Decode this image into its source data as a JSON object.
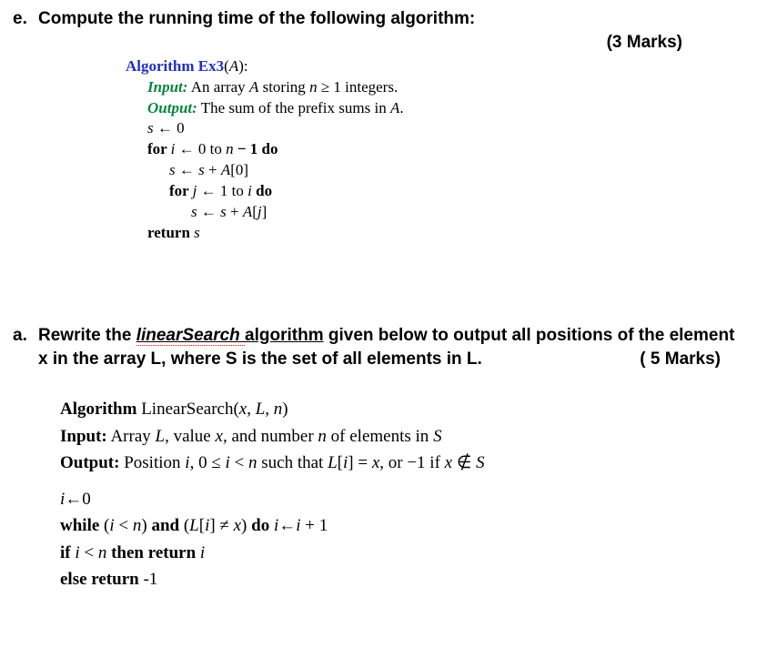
{
  "qE": {
    "letter": "e.",
    "text": "Compute the running time of the following algorithm:",
    "marks": "(3 Marks)",
    "algo": {
      "header": "Algorithm",
      "name": "Ex3",
      "paramOpen": "(",
      "param": "A",
      "paramClose": "):",
      "inputLabel": "Input:",
      "inputText1": " An array ",
      "inputA": "A",
      "inputText2": " storing ",
      "inputN": "n",
      "inputText3": " ≥ 1 integers.",
      "outputLabel": "Output:",
      "outputText1": " The sum of the prefix sums in ",
      "outputA": "A",
      "outputText2": ".",
      "l1a": "s",
      "l1b": " ← 0",
      "l2a": "for ",
      "l2b": "i",
      "l2c": " ← 0 to ",
      "l2d": "n",
      "l2e": " − 1 do",
      "l3a": "s",
      "l3b": " ← ",
      "l3c": "s",
      "l3d": " + ",
      "l3e": "A",
      "l3f": "[0]",
      "l4a": "for ",
      "l4b": "j",
      "l4c": " ← 1 to ",
      "l4d": "i",
      "l4e": " do",
      "l5a": "s",
      "l5b": " ← ",
      "l5c": "s",
      "l5d": " + ",
      "l5e": "A",
      "l5f": "[",
      "l5g": "j",
      "l5h": "]",
      "l6a": "return ",
      "l6b": "s"
    }
  },
  "qA": {
    "letter": "a.",
    "part1": "Rewrite the ",
    "linear": "linearSearch ",
    "algoW": "algorithm",
    "part2": " given below to output all positions of the element x in the array L, where S is the set of all elements in L.",
    "marks": "( 5 Marks)",
    "ls": {
      "hdr": "Algorithm",
      "name": " LinearSearch(",
      "args": "x, L, n",
      "close": ")",
      "inLbl": "Input:",
      "inTxt1": "  Array ",
      "inL": "L",
      "inTxt2": ", value ",
      "inX": "x",
      "inTxt3": ", and number ",
      "inN": "n",
      "inTxt4": " of elements in ",
      "inS": "S",
      "outLbl": "Output:",
      "outTxt1": "  Position ",
      "outI": "i",
      "outTxt2": ", 0 ≤ ",
      "outI2": "i",
      "outTxt3": " < ",
      "outN": "n",
      "outTxt4": " such that  ",
      "outLi": "L",
      "outBr1": "[",
      "outI3": "i",
      "outBr2": "] = ",
      "outX": "x",
      "outTxt5": ", or −1 if ",
      "outX2": "x",
      "outNotIn": " ∉ ",
      "outS": "S",
      "b1a": "i",
      "b1b": "←0",
      "b2a": "while",
      "b2b": " (",
      "b2c": "i",
      "b2d": " < ",
      "b2e": "n",
      "b2f": ") ",
      "b2g": "and",
      "b2h": " (",
      "b2i": "L",
      "b2j": "[",
      "b2k": "i",
      "b2l": "] ≠ ",
      "b2m": "x",
      "b2n": ") ",
      "b2o": "do",
      "b2p": " ",
      "b2q": "i",
      "b2r": "←",
      "b2s": "i",
      "b2t": " + 1",
      "b3a": "if",
      "b3b": " ",
      "b3c": "i",
      "b3d": " < ",
      "b3e": "n",
      "b3f": " ",
      "b3g": "then return",
      "b3h": " ",
      "b3i": "i",
      "b4a": "else return",
      "b4b": " -1"
    }
  }
}
